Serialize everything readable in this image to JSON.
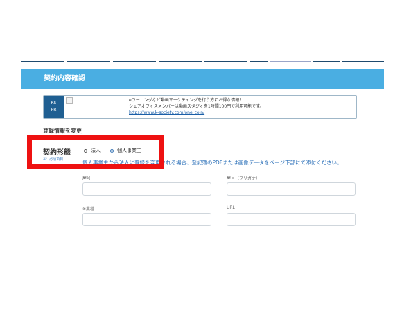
{
  "header": {
    "title": "契約内容確認"
  },
  "ad": {
    "badge_line1": "KS",
    "badge_line2": "PR",
    "line1": "eラーニングなど動画マーケティングを行う方にお得な情報！",
    "line2": "シェアオフィスメンバーは動画スタジオを1時間100円で利用可能です。",
    "link": "https://www.k-society.com/one_coin/"
  },
  "section": {
    "heading": "登録情報を変更"
  },
  "contract": {
    "label": "契約形態",
    "required_note": "※：必須項目",
    "options": [
      {
        "label": "法人",
        "selected": false
      },
      {
        "label": "個人事業主",
        "selected": true
      }
    ],
    "note": "個人事業主から法人に登録を変更される場合、登記簿のPDFまたは画像データをページ下部にて添付ください。"
  },
  "fields": {
    "trade_name": {
      "label": "屋号",
      "value": ""
    },
    "trade_name_kana": {
      "label": "屋号（フリガナ）",
      "value": ""
    },
    "industry": {
      "label": "※業種",
      "value": ""
    },
    "url": {
      "label": "URL",
      "value": ""
    }
  },
  "colors": {
    "header_bg": "#4aaee2",
    "highlight": "#ee1111",
    "note_text": "#2a6fb8",
    "badge_bg": "#1f5f92"
  }
}
